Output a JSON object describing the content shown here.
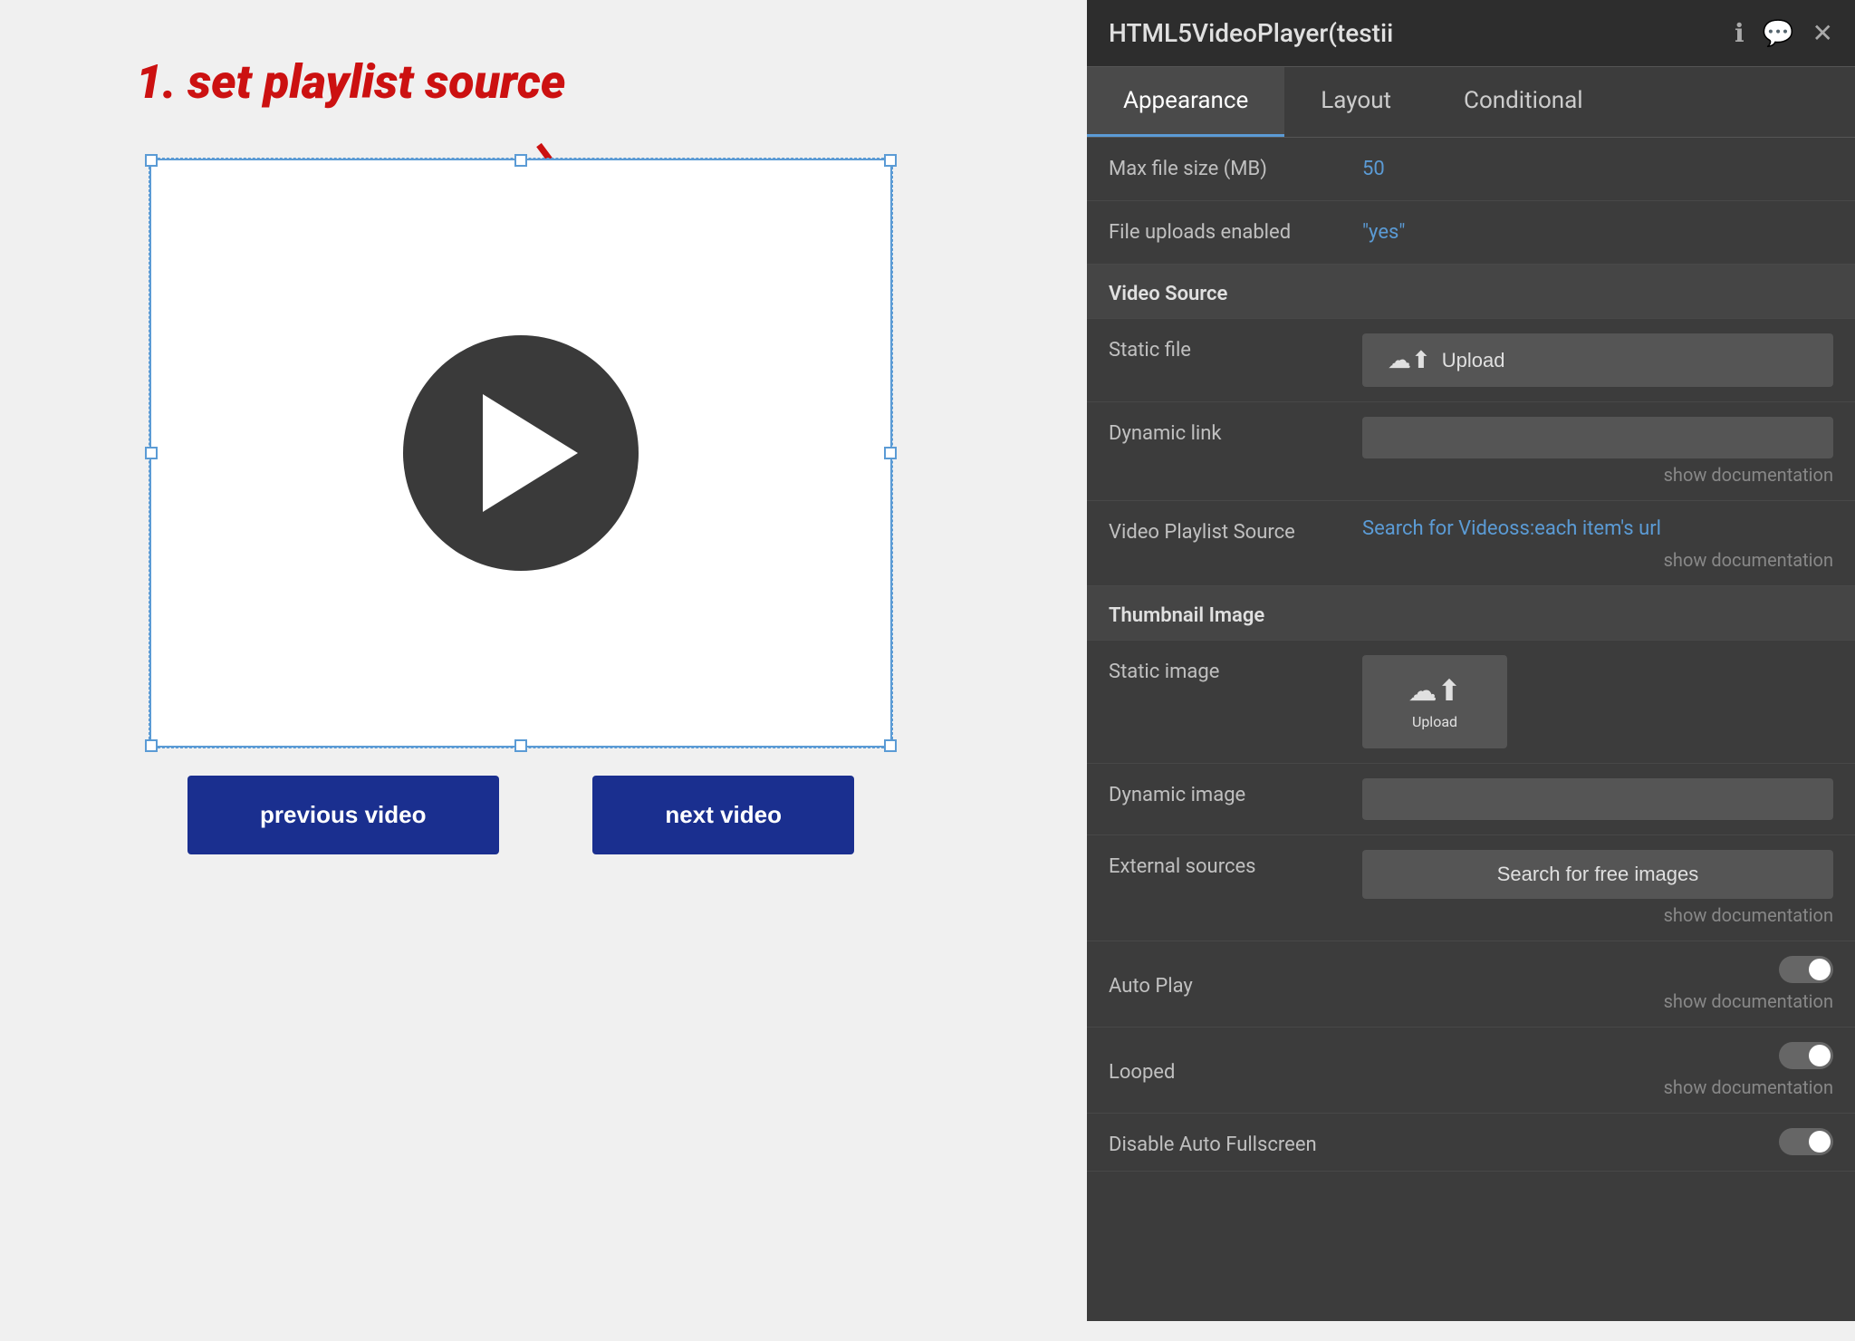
{
  "canvas": {
    "annotation": "1. set playlist source",
    "video_widget": {
      "prev_button": "previous video",
      "next_button": "next video"
    }
  },
  "panel": {
    "title": "HTML5VideoPlayer(testii",
    "tabs": [
      {
        "label": "Appearance",
        "active": true
      },
      {
        "label": "Layout",
        "active": false
      },
      {
        "label": "Conditional",
        "active": false
      }
    ],
    "properties": [
      {
        "label": "Max file size (MB)",
        "value": "50",
        "type": "number"
      },
      {
        "label": "File uploads enabled",
        "value": "\"yes\"",
        "type": "string"
      },
      {
        "section": "Video Source"
      },
      {
        "label": "Static file",
        "type": "upload"
      },
      {
        "label": "Dynamic link",
        "type": "input",
        "show_doc": "show documentation"
      },
      {
        "label": "Video Playlist Source",
        "value": "Search for Videoss:each item's url",
        "type": "link",
        "show_doc": "show documentation"
      },
      {
        "section": "Thumbnail Image"
      },
      {
        "label": "Static image",
        "type": "upload-area"
      },
      {
        "label": "Dynamic image",
        "type": "input"
      },
      {
        "label": "External sources",
        "type": "search-btn",
        "value": "Search for free images",
        "show_doc": "show documentation"
      },
      {
        "label": "Auto Play",
        "type": "toggle",
        "show_doc": "show documentation"
      },
      {
        "label": "Looped",
        "type": "toggle",
        "show_doc": "show documentation"
      },
      {
        "label": "Disable Auto Fullscreen",
        "type": "toggle"
      }
    ]
  },
  "icons": {
    "info": "ℹ",
    "comment": "💬",
    "close": "✕",
    "upload_cloud": "☁",
    "upload_arrow": "⬆"
  }
}
